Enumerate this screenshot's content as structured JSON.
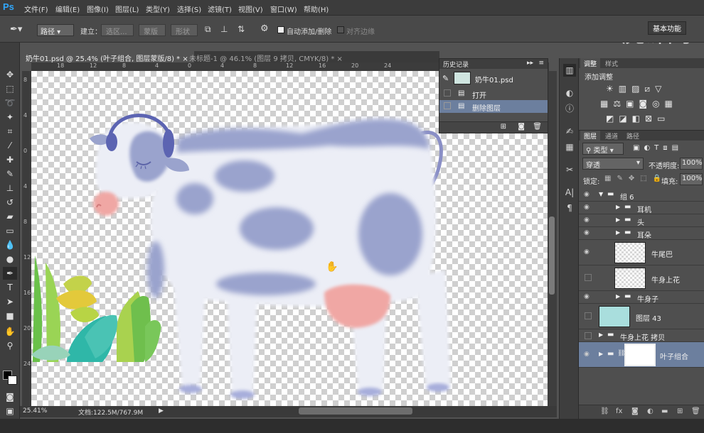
{
  "app": {
    "logo": "Ps",
    "watermark": "虎课网"
  },
  "menu": [
    "文件(F)",
    "编辑(E)",
    "图像(I)",
    "图层(L)",
    "类型(Y)",
    "选择(S)",
    "滤镜(T)",
    "视图(V)",
    "窗口(W)",
    "帮助(H)"
  ],
  "options": {
    "mode": "路径",
    "create_label": "建立：",
    "selection_btn": "选区...",
    "mask_btn": "蒙版",
    "shape_btn": "形状",
    "auto_add_label": "自动添加/删除",
    "auto_add_checked": true,
    "align_edges_label": "对齐边缘",
    "align_edges_checked": false,
    "workspace": "基本功能"
  },
  "doc_tabs": [
    {
      "title": "奶牛01.psd @ 25.4% (叶子组合, 图层蒙版/8) *",
      "active": true
    },
    {
      "title": "未标题-1 @ 46.1% (图层 9 拷贝, CMYK/8) *",
      "active": false
    }
  ],
  "ruler": {
    "h_ticks": [
      "18",
      "12",
      "8",
      "4",
      "0",
      "4",
      "8",
      "12",
      "16",
      "20",
      "24"
    ],
    "v_ticks": [
      "8",
      "4",
      "0",
      "4",
      "8",
      "12",
      "16",
      "20",
      "24"
    ]
  },
  "status": {
    "zoom": "25.41%",
    "doc": "文档:122.5M/767.9M"
  },
  "history": {
    "title": "历史记录",
    "snapshot": "奶牛01.psd",
    "items": [
      {
        "label": "打开",
        "selected": false
      },
      {
        "label": "删除图层",
        "selected": true
      }
    ]
  },
  "adjustments": {
    "tabs": [
      "调整",
      "样式"
    ],
    "title": "添加调整"
  },
  "layers_panel": {
    "tabs": [
      "图层",
      "通道",
      "路径"
    ],
    "filter_kind": "类型",
    "blend_mode": "穿透",
    "opacity_label": "不透明度:",
    "opacity": "100%",
    "lock_label": "锁定:",
    "fill_label": "填充:",
    "fill": "100%",
    "layers": [
      {
        "name": "组 6",
        "type": "group",
        "visible": true,
        "indent": 0,
        "open": true
      },
      {
        "name": "耳机",
        "type": "group",
        "visible": true,
        "indent": 1
      },
      {
        "name": "头",
        "type": "group",
        "visible": true,
        "indent": 1
      },
      {
        "name": "耳朵",
        "type": "group",
        "visible": true,
        "indent": 1
      },
      {
        "name": "牛尾巴",
        "type": "layer",
        "visible": true,
        "indent": 1
      },
      {
        "name": "牛身上花",
        "type": "layer",
        "visible": false,
        "indent": 1
      },
      {
        "name": "牛身子",
        "type": "group",
        "visible": true,
        "indent": 1
      },
      {
        "name": "图层 43",
        "type": "layer",
        "visible": false,
        "indent": 0,
        "color": "#a9dedd"
      },
      {
        "name": "牛身上花 拷贝",
        "type": "group",
        "visible": false,
        "indent": 0
      },
      {
        "name": "叶子组合",
        "type": "group-mask",
        "visible": true,
        "indent": 0,
        "selected": true
      }
    ]
  },
  "colors": {
    "panel": "#4f4f4f",
    "selected": "#6c7f9e",
    "cow_blue": "#9aa3cd",
    "udder": "#f0a7a4"
  }
}
